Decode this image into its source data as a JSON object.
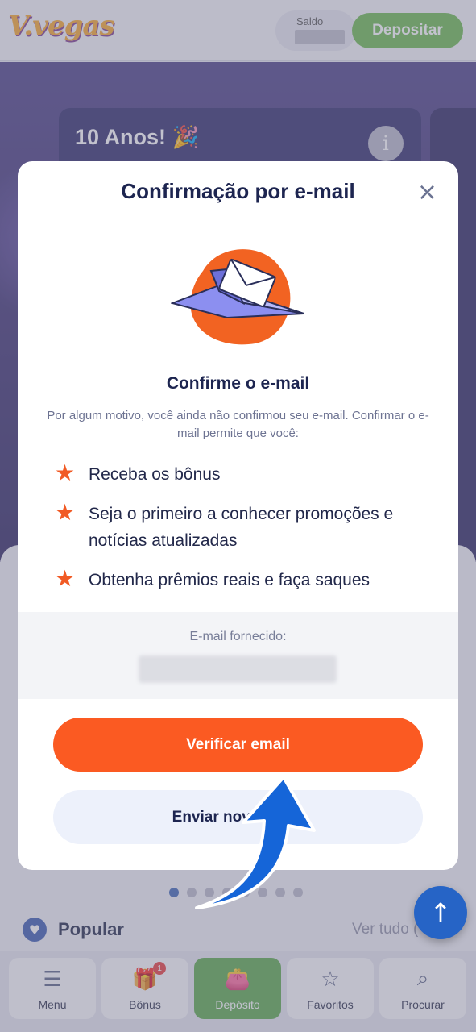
{
  "header": {
    "logo": "V.vegas",
    "balance_label": "Saldo",
    "deposit_label": "Depositar"
  },
  "banner": {
    "title": "10 Anos! 🎉",
    "info": "i"
  },
  "carousel": {
    "dot_count": 8,
    "active_index": 0
  },
  "section": {
    "title": "Popular",
    "see_all": "Ver tudo ("
  },
  "scroll_top": "↑",
  "bottom_nav": [
    {
      "label": "Menu",
      "icon": "menu-icon",
      "glyph": "☰"
    },
    {
      "label": "Bônus",
      "icon": "gift-icon",
      "glyph": "🎁",
      "badge": "1"
    },
    {
      "label": "Depósito",
      "icon": "wallet-icon",
      "glyph": "👛"
    },
    {
      "label": "Favoritos",
      "icon": "star-icon",
      "glyph": "☆"
    },
    {
      "label": "Procurar",
      "icon": "search-icon",
      "glyph": "⌕"
    }
  ],
  "modal": {
    "title": "Confirmação por e-mail",
    "close": "×",
    "subtitle": "Confirme o e-mail",
    "description": "Por algum motivo, você ainda não confirmou seu e-mail. Confirmar o e-mail permite que você:",
    "benefits": [
      "Receba os bônus",
      "Seja o primeiro a conhecer promoções e notícias atualizadas",
      "Obtenha prêmios reais e faça saques"
    ],
    "email_label": "E-mail fornecido:",
    "verify_button": "Verificar email",
    "resend_button": "Enviar novamente"
  },
  "colors": {
    "accent_orange": "#fb5a22",
    "deposit_green": "#6bb94e",
    "navy": "#1d2550",
    "pointer_blue": "#1565d8"
  }
}
